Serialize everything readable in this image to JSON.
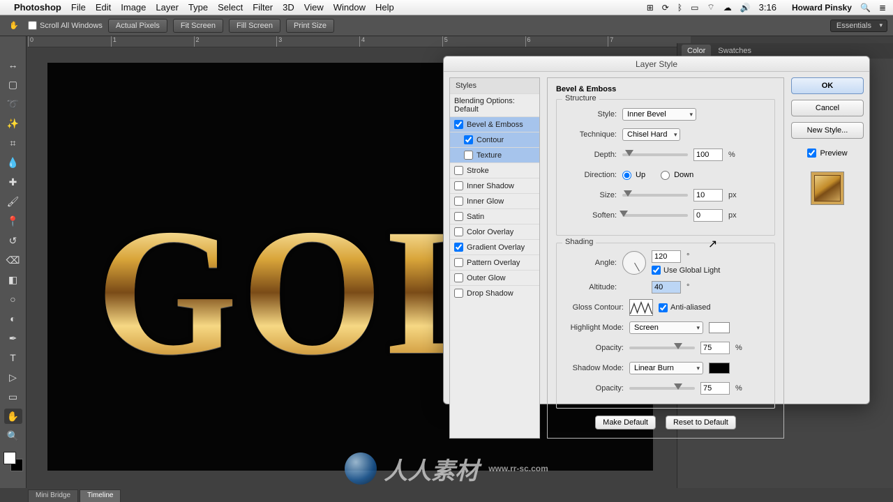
{
  "menubar": {
    "apple": "",
    "app": "Photoshop",
    "items": [
      "File",
      "Edit",
      "Image",
      "Layer",
      "Type",
      "Select",
      "Filter",
      "3D",
      "View",
      "Window",
      "Help"
    ],
    "clock": "3:16",
    "user": "Howard Pinsky"
  },
  "options_bar": {
    "scroll_all": "Scroll All Windows",
    "buttons": [
      "Actual Pixels",
      "Fit Screen",
      "Fill Screen",
      "Print Size"
    ],
    "workspace": "Essentials"
  },
  "ruler_ticks": [
    "0",
    "1",
    "2",
    "3",
    "4",
    "5",
    "6",
    "7"
  ],
  "right_panels": {
    "tabs": [
      "Color",
      "Swatches"
    ]
  },
  "bottom_tabs": [
    "Mini Bridge",
    "Timeline"
  ],
  "canvas": {
    "gold_text": "GOL"
  },
  "dialog": {
    "title": "Layer Style",
    "styles_header": "Styles",
    "blending_default": "Blending Options: Default",
    "styles": [
      {
        "label": "Bevel & Emboss",
        "checked": true,
        "selected": true
      },
      {
        "label": "Contour",
        "checked": true,
        "indent": true
      },
      {
        "label": "Texture",
        "checked": false,
        "indent": true
      },
      {
        "label": "Stroke",
        "checked": false
      },
      {
        "label": "Inner Shadow",
        "checked": false
      },
      {
        "label": "Inner Glow",
        "checked": false
      },
      {
        "label": "Satin",
        "checked": false
      },
      {
        "label": "Color Overlay",
        "checked": false
      },
      {
        "label": "Gradient Overlay",
        "checked": true
      },
      {
        "label": "Pattern Overlay",
        "checked": false
      },
      {
        "label": "Outer Glow",
        "checked": false
      },
      {
        "label": "Drop Shadow",
        "checked": false
      }
    ],
    "section_title": "Bevel & Emboss",
    "structure": {
      "legend": "Structure",
      "style_label": "Style:",
      "style_value": "Inner Bevel",
      "technique_label": "Technique:",
      "technique_value": "Chisel Hard",
      "depth_label": "Depth:",
      "depth_value": "100",
      "depth_unit": "%",
      "direction_label": "Direction:",
      "up": "Up",
      "down": "Down",
      "size_label": "Size:",
      "size_value": "10",
      "size_unit": "px",
      "soften_label": "Soften:",
      "soften_value": "0",
      "soften_unit": "px"
    },
    "shading": {
      "legend": "Shading",
      "angle_label": "Angle:",
      "angle_value": "120",
      "use_global": "Use Global Light",
      "altitude_label": "Altitude:",
      "altitude_value": "40",
      "gloss_label": "Gloss Contour:",
      "antialiased": "Anti-aliased",
      "highlight_mode_label": "Highlight Mode:",
      "highlight_mode_value": "Screen",
      "highlight_opacity_label": "Opacity:",
      "highlight_opacity_value": "75",
      "pct": "%",
      "shadow_mode_label": "Shadow Mode:",
      "shadow_mode_value": "Linear Burn",
      "shadow_opacity_label": "Opacity:",
      "shadow_opacity_value": "75",
      "highlight_color": "#ffffff",
      "shadow_color": "#000000"
    },
    "make_default": "Make Default",
    "reset_default": "Reset to Default",
    "ok": "OK",
    "cancel": "Cancel",
    "new_style": "New Style...",
    "preview": "Preview"
  },
  "watermark": {
    "text": "人人素材",
    "sub": "www.rr-sc.com"
  }
}
